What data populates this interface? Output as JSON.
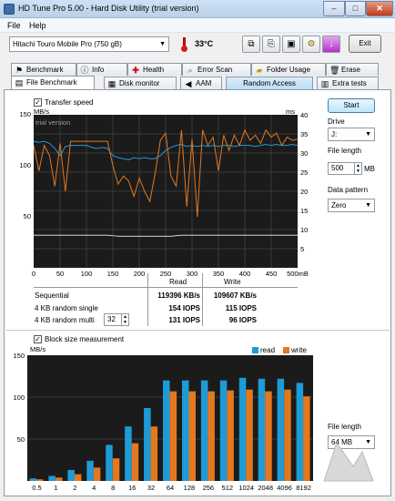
{
  "window": {
    "title": "HD Tune Pro 5.00 - Hard Disk Utility (trial version)",
    "minimize": "–",
    "maximize": "□",
    "close": "✕"
  },
  "menu": [
    {
      "label": "File"
    },
    {
      "label": "Help"
    }
  ],
  "toolbar": {
    "drive": "Hitachi Touro Mobile Pro (750 gB)",
    "temperature": "33°C",
    "exit_label": "Exit",
    "icons": [
      "copy-icon",
      "copy-text-icon",
      "save-icon",
      "options-icon",
      "download-icon"
    ]
  },
  "tabs_row1": [
    {
      "label": "Benchmark",
      "icon": "benchmark-icon"
    },
    {
      "label": "Info",
      "icon": "info-icon"
    },
    {
      "label": "Health",
      "icon": "health-icon"
    },
    {
      "label": "Error Scan",
      "icon": "error-scan-icon"
    },
    {
      "label": "Folder Usage",
      "icon": "folder-icon"
    },
    {
      "label": "Erase",
      "icon": "erase-icon"
    }
  ],
  "tabs_row2": [
    {
      "label": "File Benchmark",
      "icon": "file-benchmark-icon",
      "active": true
    },
    {
      "label": "Disk monitor",
      "icon": "disk-monitor-icon"
    },
    {
      "label": "AAM",
      "icon": "aam-icon"
    },
    {
      "label": "Random Access",
      "icon": ""
    },
    {
      "label": "Extra tests",
      "icon": "extra-tests-icon"
    }
  ],
  "transfer": {
    "checkbox_label": "Transfer speed",
    "checked": true,
    "y_left_unit": "MB/s",
    "y_right_unit": "ms",
    "watermark": "trial version",
    "y_left_ticks": [
      "150",
      "100",
      "50"
    ],
    "y_right_ticks": [
      "40",
      "35",
      "30",
      "25",
      "20",
      "15",
      "10",
      "5"
    ],
    "x_ticks": [
      "0",
      "50",
      "100",
      "150",
      "200",
      "250",
      "300",
      "350",
      "400",
      "450",
      "500mB"
    ]
  },
  "results": {
    "col_read": "Read",
    "col_write": "Write",
    "multi_queue": "32",
    "rows": [
      {
        "label": "Sequential",
        "read": "119396 KB/s",
        "write": "109607 KB/s"
      },
      {
        "label": "4 KB random single",
        "read": "154 IOPS",
        "write": "115 IOPS"
      },
      {
        "label": "4 KB random multi",
        "read": "131 IOPS",
        "write": "96 IOPS"
      }
    ]
  },
  "side": {
    "start_label": "Start",
    "drive_label": "Drive",
    "drive_value": "J:",
    "file_length_label": "File length",
    "file_length_value": "500",
    "file_length_unit": "MB",
    "pattern_label": "Data pattern",
    "pattern_value": "Zero",
    "block_file_length_label": "File length",
    "block_file_length_value": "64 MB"
  },
  "block": {
    "checkbox_label": "Block size measurement",
    "checked": true,
    "unit": "MB/s",
    "y_ticks": [
      "150",
      "100",
      "50"
    ],
    "legend": [
      {
        "name": "read",
        "color": "#1e9bd7"
      },
      {
        "name": "write",
        "color": "#e3781e"
      }
    ]
  },
  "chart_data": [
    {
      "type": "line",
      "xlabel": "",
      "ylabel": "MB/s",
      "x_unit": "mB",
      "xlim": [
        0,
        500
      ],
      "ylim": [
        0,
        150
      ],
      "y2lim": [
        0,
        40
      ],
      "series": [
        {
          "color": "#1e9bd7",
          "x": [
            0,
            10,
            20,
            30,
            40,
            50,
            60,
            70,
            80,
            90,
            100,
            110,
            120,
            130,
            140,
            150,
            160,
            170,
            180,
            190,
            200,
            210,
            220,
            230,
            240,
            250,
            260,
            270,
            280,
            290,
            300,
            310,
            320,
            330,
            340,
            350,
            360,
            370,
            380,
            390,
            400,
            410,
            420,
            430,
            440,
            450,
            460,
            470,
            480,
            490,
            500
          ],
          "values": [
            124,
            123,
            124,
            122,
            117,
            110,
            119,
            120,
            120,
            120,
            120,
            118,
            117,
            118,
            117,
            110,
            108,
            107,
            106,
            108,
            107,
            108,
            107,
            107,
            110,
            115,
            118,
            120,
            121,
            119,
            120,
            119,
            120,
            119,
            120,
            119,
            120,
            120,
            119,
            120,
            120,
            120,
            119,
            120,
            121,
            120,
            121,
            120,
            120,
            121,
            120
          ]
        },
        {
          "color": "#e3781e",
          "x": [
            0,
            10,
            20,
            30,
            40,
            50,
            60,
            70,
            80,
            90,
            100,
            110,
            120,
            130,
            140,
            150,
            160,
            170,
            180,
            190,
            200,
            210,
            220,
            230,
            240,
            250,
            260,
            270,
            280,
            290,
            300,
            310,
            320,
            330,
            340,
            350,
            360,
            370,
            380,
            390,
            400,
            410,
            420,
            430,
            440,
            450,
            460,
            470,
            480,
            490,
            500
          ],
          "values": [
            120,
            95,
            120,
            110,
            80,
            122,
            75,
            124,
            124,
            124,
            124,
            124,
            124,
            124,
            124,
            100,
            82,
            90,
            85,
            70,
            88,
            75,
            65,
            92,
            125,
            132,
            90,
            80,
            135,
            60,
            126,
            50,
            135,
            120,
            128,
            95,
            130,
            115,
            130,
            120,
            135,
            125,
            130,
            122,
            135,
            128,
            132,
            120,
            128,
            125,
            126
          ]
        },
        {
          "color": "#f0f0f0",
          "x": [
            0,
            20,
            40,
            60,
            80,
            100,
            120,
            140,
            160,
            180,
            200,
            220,
            240,
            260,
            280,
            300,
            320,
            340,
            360,
            380,
            400,
            420,
            440,
            460,
            480,
            500
          ],
          "values": [
            32,
            32,
            32,
            32,
            32,
            32,
            32,
            32,
            31,
            31,
            31,
            31,
            31,
            31,
            32,
            32,
            32,
            32,
            32,
            32,
            32,
            32,
            32,
            32,
            32,
            32
          ]
        }
      ]
    },
    {
      "type": "bar",
      "ylabel": "MB/s",
      "ylim": [
        0,
        150
      ],
      "categories": [
        "0.5",
        "1",
        "2",
        "4",
        "8",
        "16",
        "32",
        "64",
        "128",
        "256",
        "512",
        "1024",
        "2048",
        "4096",
        "8192"
      ],
      "series": [
        {
          "name": "read",
          "values": [
            3,
            6,
            13,
            24,
            43,
            65,
            87,
            120,
            120,
            120,
            120,
            123,
            122,
            122,
            117
          ]
        },
        {
          "name": "write",
          "values": [
            2,
            4,
            8,
            16,
            27,
            45,
            65,
            107,
            107,
            107,
            108,
            109,
            107,
            109,
            101
          ]
        }
      ]
    }
  ]
}
